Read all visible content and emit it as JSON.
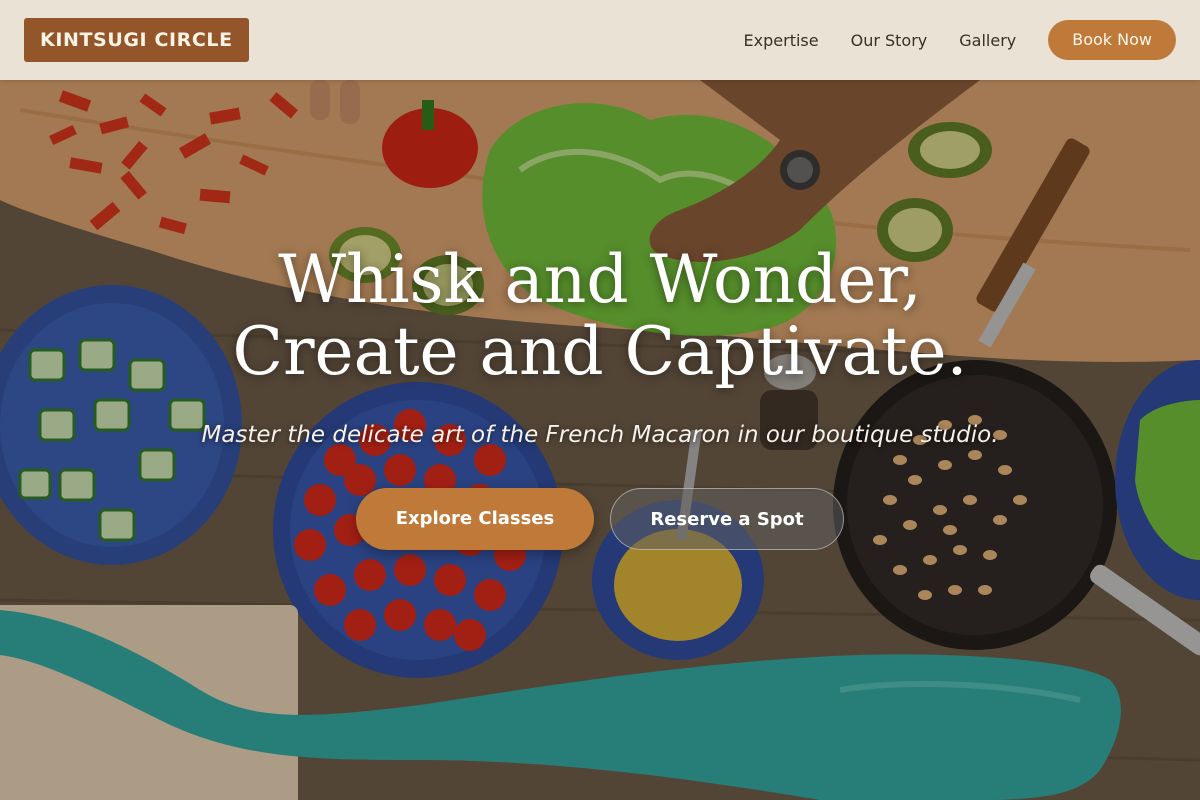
{
  "header": {
    "logo_text": "KINTSUGI CIRCLE",
    "nav": [
      {
        "label": "Expertise"
      },
      {
        "label": "Our Story"
      },
      {
        "label": "Gallery"
      }
    ],
    "cta_label": "Book Now"
  },
  "hero": {
    "title": "Whisk and Wonder, Create and Captivate.",
    "subtitle": "Master the delicate art of the French Macaron in our boutique studio.",
    "primary_cta": "Explore Classes",
    "secondary_cta": "Reserve a Spot"
  },
  "colors": {
    "brand": "#93562a",
    "accent": "#bf7a3a",
    "header_bg": "#f3ecde"
  }
}
